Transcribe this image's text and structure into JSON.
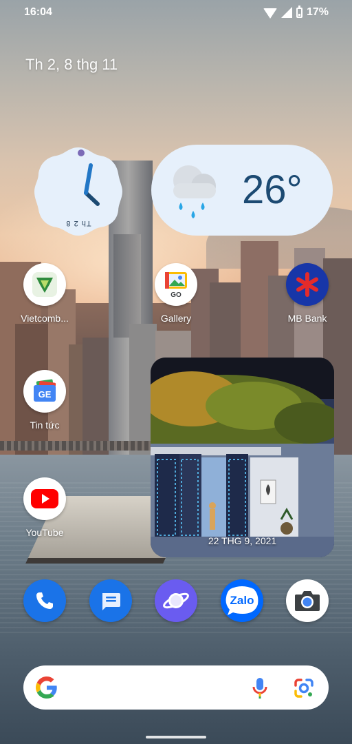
{
  "status_bar": {
    "time": "16:04",
    "battery_percent": "17%",
    "icons": [
      "wifi-icon",
      "cell-signal-icon",
      "battery-icon"
    ]
  },
  "date_widget": {
    "text": "Th 2, 8 thg 11"
  },
  "clock_widget": {
    "date_text": "Th 2 8"
  },
  "weather_widget": {
    "temperature": "26°",
    "condition_icon": "rain-cloud-icon"
  },
  "apps": [
    {
      "label": "Vietcomb...",
      "icon": "vietcombank-icon"
    },
    {
      "label": "Gallery",
      "icon": "gallery-go-icon",
      "badge": "GO"
    },
    {
      "label": "MB Bank",
      "icon": "mb-bank-icon"
    },
    {
      "label": "Tin tức",
      "icon": "google-news-icon",
      "badge": "GE"
    },
    {
      "label": "YouTube",
      "icon": "youtube-icon"
    }
  ],
  "photo_widget": {
    "caption": "22 THG 9, 2021"
  },
  "dock": [
    {
      "name": "phone",
      "icon": "phone-icon",
      "color": "#1a73e8"
    },
    {
      "name": "messages",
      "icon": "messages-icon",
      "color": "#1a73e8"
    },
    {
      "name": "samsung-internet",
      "icon": "internet-planet-icon",
      "color": "#6a5cf0"
    },
    {
      "name": "zalo",
      "icon": "zalo-icon",
      "label": "Zalo",
      "color": "#0068ff"
    },
    {
      "name": "camera",
      "icon": "camera-icon",
      "color": "#ffffff"
    }
  ],
  "search_bar": {
    "icons": [
      "google-g-icon",
      "microphone-icon",
      "google-lens-icon"
    ]
  }
}
